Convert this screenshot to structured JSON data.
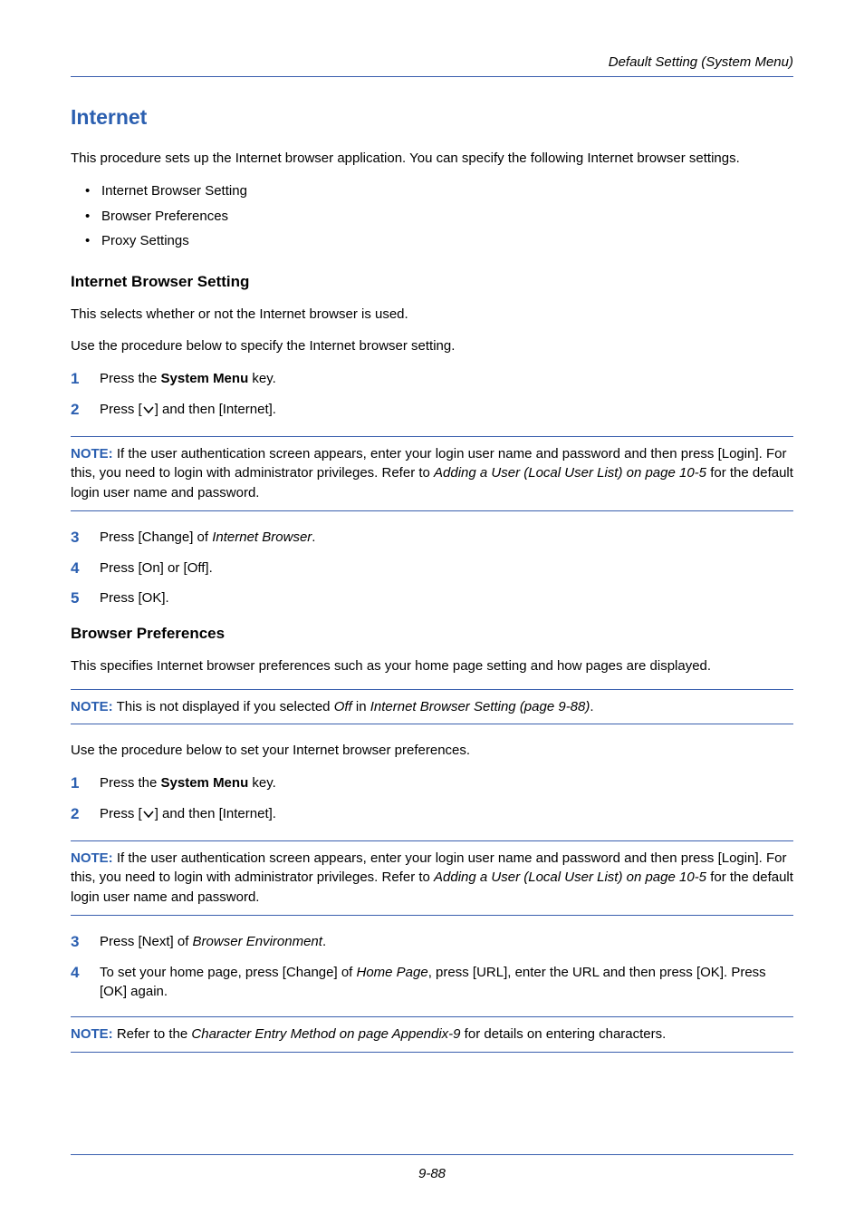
{
  "header": {
    "breadcrumb": "Default Setting (System Menu)"
  },
  "title": "Internet",
  "intro": "This procedure sets up the Internet browser application. You can specify the following Internet browser settings.",
  "bullets": [
    "Internet Browser Setting",
    "Browser Preferences",
    "Proxy Settings"
  ],
  "s1": {
    "heading": "Internet Browser Setting",
    "p1": "This selects whether or not the Internet browser is used.",
    "p2": "Use the procedure below to specify the Internet browser setting.",
    "steps_a": {
      "1_pre": "Press the ",
      "1_bold": "System Menu",
      "1_post": " key.",
      "2_pre": "Press [",
      "2_post": "] and then [Internet]."
    },
    "note": {
      "label": "NOTE:",
      "t1": " If the user authentication screen appears, enter your login user name and password and then press [Login]. For this, you need to login with administrator privileges. Refer to ",
      "t2_italic": "Adding a User (Local User List) on page 10-5",
      "t3": " for the default login user name and password."
    },
    "steps_b": {
      "3_pre": "Press [Change] of ",
      "3_italic": "Internet Browser",
      "3_post": ".",
      "4": "Press [On] or [Off].",
      "5": "Press [OK]."
    }
  },
  "s2": {
    "heading": "Browser Preferences",
    "p1": "This specifies Internet browser preferences such as your home page setting and how pages are displayed.",
    "note1": {
      "label": "NOTE:",
      "t1": " This is not displayed if you selected ",
      "t2_italic": "Off",
      "t3": " in ",
      "t4_italic": "Internet Browser Setting (page 9-88)",
      "t5": "."
    },
    "p2": "Use the procedure below to set your Internet browser preferences.",
    "steps_a": {
      "1_pre": "Press the ",
      "1_bold": "System Menu",
      "1_post": " key.",
      "2_pre": "Press [",
      "2_post": "] and then [Internet]."
    },
    "note2": {
      "label": "NOTE:",
      "t1": " If the user authentication screen appears, enter your login user name and password and then press [Login]. For this, you need to login with administrator privileges. Refer to ",
      "t2_italic": "Adding a User (Local User List) on page 10-5",
      "t3": " for the default login user name and password."
    },
    "steps_b": {
      "3_pre": "Press [Next] of ",
      "3_italic": "Browser Environment",
      "3_post": ".",
      "4_pre": "To set your home page, press [Change] of ",
      "4_italic": "Home Page",
      "4_post": ", press [URL], enter the URL and then press [OK]. Press [OK] again."
    },
    "note3": {
      "label": "NOTE:",
      "t1": " Refer to the ",
      "t2_italic": "Character Entry Method on page Appendix-9",
      "t3": " for details on entering characters."
    }
  },
  "footer": {
    "page": "9-88"
  }
}
